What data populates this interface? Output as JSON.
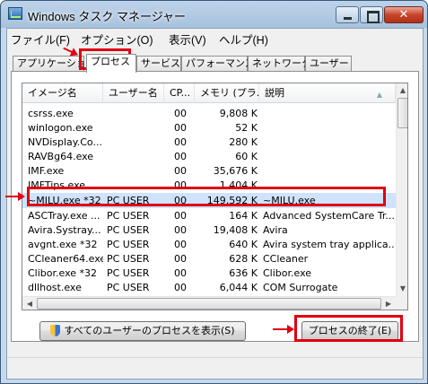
{
  "window": {
    "title": "Windows タスク マネージャー",
    "close_glyph": "✕"
  },
  "menu": [
    "ファイル(F)",
    "オプション(O)",
    "表示(V)",
    "ヘルプ(H)"
  ],
  "tabs": [
    {
      "label": "アプリケーション",
      "active": false
    },
    {
      "label": "プロセス",
      "active": true
    },
    {
      "label": "サービス",
      "active": false
    },
    {
      "label": "パフォーマンス",
      "active": false
    },
    {
      "label": "ネットワーク",
      "active": false
    },
    {
      "label": "ユーザー",
      "active": false
    }
  ],
  "table": {
    "columns": [
      "イメージ名",
      "ユーザー名",
      "CP...",
      "メモリ (プラ...",
      "説明"
    ],
    "rows": [
      {
        "image": "csrss.exe",
        "user": "",
        "cpu": "00",
        "mem": "9,808 K",
        "desc": ""
      },
      {
        "image": "winlogon.exe",
        "user": "",
        "cpu": "00",
        "mem": "52 K",
        "desc": ""
      },
      {
        "image": "NVDisplay.Co...",
        "user": "",
        "cpu": "00",
        "mem": "280 K",
        "desc": ""
      },
      {
        "image": "RAVBg64.exe",
        "user": "",
        "cpu": "00",
        "mem": "60 K",
        "desc": ""
      },
      {
        "image": "IMF.exe",
        "user": "",
        "cpu": "00",
        "mem": "35,676 K",
        "desc": ""
      },
      {
        "image": "IMFTips.exe",
        "user": "",
        "cpu": "00",
        "mem": "1,404 K",
        "desc": ""
      },
      {
        "image": "~MILU.exe *32",
        "user": "PC USER",
        "cpu": "00",
        "mem": "149,592 K",
        "desc": "~MILU.exe",
        "selected": true
      },
      {
        "image": "ASCTray.exe ...",
        "user": "PC USER",
        "cpu": "00",
        "mem": "164 K",
        "desc": "Advanced SystemCare Tr..."
      },
      {
        "image": "Avira.Systray...",
        "user": "PC USER",
        "cpu": "00",
        "mem": "19,408 K",
        "desc": "Avira"
      },
      {
        "image": "avgnt.exe *32",
        "user": "PC USER",
        "cpu": "00",
        "mem": "640 K",
        "desc": "Avira system tray applica..."
      },
      {
        "image": "CCleaner64.exe",
        "user": "PC USER",
        "cpu": "00",
        "mem": "628 K",
        "desc": "CCleaner"
      },
      {
        "image": "Clibor.exe *32",
        "user": "PC USER",
        "cpu": "00",
        "mem": "636 K",
        "desc": "Clibor.exe"
      },
      {
        "image": "dllhost.exe",
        "user": "PC USER",
        "cpu": "00",
        "mem": "6,044 K",
        "desc": "COM Surrogate"
      }
    ]
  },
  "buttons": {
    "show_all_users": "すべてのユーザーのプロセスを表示(S)",
    "end_process": "プロセスの終了(E)"
  },
  "icons": {
    "app": "task-manager-icon",
    "uac": "uac-shield-icon"
  },
  "colors": {
    "annotation_red": "#e00010",
    "selection": "#cfe3fc"
  }
}
